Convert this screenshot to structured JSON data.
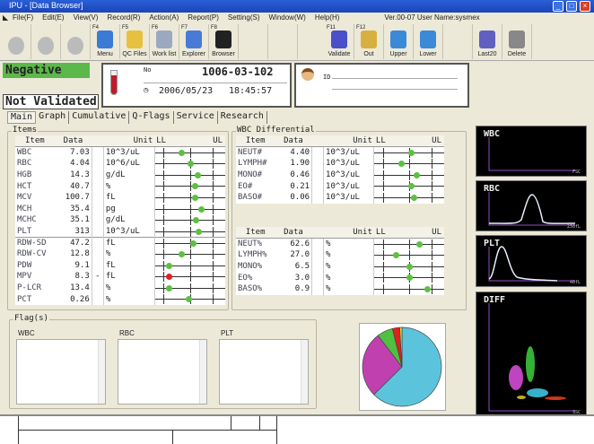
{
  "window": {
    "title": "IPU - [Data Browser]",
    "minimize": "_",
    "maximize": "□",
    "close": "×"
  },
  "menu": [
    "File(F)",
    "Edit(E)",
    "View(V)",
    "Record(R)",
    "Action(A)",
    "Report(P)",
    "Setting(S)",
    "Window(W)",
    "Help(H)"
  ],
  "version": "Ver.00-07 User Name:sysmex",
  "toolbar": [
    {
      "fk": "",
      "label": "",
      "disabled": true
    },
    {
      "fk": "",
      "label": "",
      "disabled": true
    },
    {
      "fk": "",
      "label": "",
      "disabled": true
    },
    {
      "fk": "F4",
      "label": "Menu",
      "color": "#3a7bd5"
    },
    {
      "fk": "F5",
      "label": "QC Files",
      "color": "#e8c040"
    },
    {
      "fk": "F6",
      "label": "Work list",
      "color": "#9aa8c0"
    },
    {
      "fk": "F7",
      "label": "Explorer",
      "color": "#4a7ad8"
    },
    {
      "fk": "F8",
      "label": "Browser",
      "color": "#222"
    },
    {
      "fk": "",
      "label": ""
    },
    {
      "fk": "",
      "label": ""
    },
    {
      "fk": "F11",
      "label": "Validate",
      "color": "#4a50c8"
    },
    {
      "fk": "F12",
      "label": "Out",
      "color": "#d8b040"
    },
    {
      "fk": "",
      "label": "Upper",
      "color": "#3a8ad8"
    },
    {
      "fk": "",
      "label": "Lower",
      "color": "#3a8ad8"
    },
    {
      "fk": "",
      "label": ""
    },
    {
      "fk": "",
      "label": "Last20",
      "color": "#6060c0"
    },
    {
      "fk": "",
      "label": "Delete",
      "color": "#888"
    }
  ],
  "status": {
    "result": "Negative",
    "validation": "Not Validated"
  },
  "sample": {
    "no_label": "No",
    "number": "1006-03-102",
    "date": "2006/05/23",
    "time": "18:45:57"
  },
  "patient": {
    "id_label": "ID"
  },
  "tabs": [
    "Main",
    "Graph",
    "Cumulative",
    "Q-Flags",
    "Service",
    "Research"
  ],
  "items": {
    "title": "Items",
    "headers": [
      "Item",
      "Data",
      "",
      "Unit",
      "LL",
      "UL"
    ],
    "rows": [
      {
        "item": "WBC",
        "data": "7.03",
        "flag": "",
        "unit": "10^3/uL",
        "pos": 0.37,
        "color": "#5cc040"
      },
      {
        "item": "RBC",
        "data": "4.04",
        "flag": "",
        "unit": "10^6/uL",
        "pos": 0.5,
        "color": "#5cc040"
      },
      {
        "item": "HGB",
        "data": "14.3",
        "flag": "",
        "unit": "g/dL",
        "pos": 0.6,
        "color": "#5cc040"
      },
      {
        "item": "HCT",
        "data": "40.7",
        "flag": "",
        "unit": "%",
        "pos": 0.57,
        "color": "#5cc040"
      },
      {
        "item": "MCV",
        "data": "100.7",
        "flag": "",
        "unit": "fL",
        "pos": 0.56,
        "color": "#5cc040"
      },
      {
        "item": "MCH",
        "data": "35.4",
        "flag": "",
        "unit": "pg",
        "pos": 0.66,
        "color": "#5cc040"
      },
      {
        "item": "MCHC",
        "data": "35.1",
        "flag": "",
        "unit": "g/dL",
        "pos": 0.58,
        "color": "#5cc040"
      },
      {
        "item": "PLT",
        "data": "313",
        "flag": "",
        "unit": "10^3/uL",
        "pos": 0.62,
        "color": "#5cc040"
      },
      {
        "item": "RDW-SD",
        "data": "47.2",
        "flag": "",
        "unit": "fL",
        "pos": 0.54,
        "color": "#5cc040"
      },
      {
        "item": "RDW-CV",
        "data": "12.8",
        "flag": "",
        "unit": "%",
        "pos": 0.38,
        "color": "#5cc040"
      },
      {
        "item": "PDW",
        "data": "9.1",
        "flag": "",
        "unit": "fL",
        "pos": 0.19,
        "color": "#5cc040"
      },
      {
        "item": "MPV",
        "data": "8.3",
        "flag": "-",
        "unit": "fL",
        "pos": 0.19,
        "color": "#e02020"
      },
      {
        "item": "P-LCR",
        "data": "13.4",
        "flag": "",
        "unit": "%",
        "pos": 0.19,
        "color": "#5cc040"
      },
      {
        "item": "PCT",
        "data": "0.26",
        "flag": "",
        "unit": "%",
        "pos": 0.48,
        "color": "#5cc040"
      }
    ]
  },
  "wbc_diff": {
    "title": "WBC Differential",
    "headers": [
      "Item",
      "Data",
      "",
      "Unit",
      "LL",
      "UL"
    ],
    "abs": [
      {
        "item": "NEUT#",
        "data": "4.40",
        "flag": "",
        "unit": "10^3/uL",
        "pos": 0.52,
        "color": "#5cc040"
      },
      {
        "item": "LYMPH#",
        "data": "1.90",
        "flag": "",
        "unit": "10^3/uL",
        "pos": 0.38,
        "color": "#5cc040"
      },
      {
        "item": "MONO#",
        "data": "0.46",
        "flag": "",
        "unit": "10^3/uL",
        "pos": 0.6,
        "color": "#5cc040"
      },
      {
        "item": "EO#",
        "data": "0.21",
        "flag": "",
        "unit": "10^3/uL",
        "pos": 0.52,
        "color": "#5cc040"
      },
      {
        "item": "BASO#",
        "data": "0.06",
        "flag": "",
        "unit": "10^3/uL",
        "pos": 0.56,
        "color": "#5cc040"
      }
    ],
    "pct": [
      {
        "item": "NEUT%",
        "data": "62.6",
        "flag": "",
        "unit": "%",
        "pos": 0.64,
        "color": "#5cc040"
      },
      {
        "item": "LYMPH%",
        "data": "27.0",
        "flag": "",
        "unit": "%",
        "pos": 0.3,
        "color": "#5cc040"
      },
      {
        "item": "MONO%",
        "data": "6.5",
        "flag": "",
        "unit": "%",
        "pos": 0.5,
        "color": "#5cc040"
      },
      {
        "item": "EO%",
        "data": "3.0",
        "flag": "",
        "unit": "%",
        "pos": 0.5,
        "color": "#5cc040"
      },
      {
        "item": "BASO%",
        "data": "0.9",
        "flag": "",
        "unit": "%",
        "pos": 0.76,
        "color": "#5cc040"
      }
    ]
  },
  "flags": {
    "title": "Flag(s)",
    "boxes": [
      "WBC",
      "RBC",
      "PLT"
    ]
  },
  "pie": [
    {
      "name": "NEUT",
      "value": 62.6,
      "color": "#5bc4dc"
    },
    {
      "name": "LYMPH",
      "value": 27.0,
      "color": "#c040b0"
    },
    {
      "name": "MONO",
      "value": 6.5,
      "color": "#50c040"
    },
    {
      "name": "EO",
      "value": 3.0,
      "color": "#e02020"
    },
    {
      "name": "BASO",
      "value": 0.9,
      "color": "#e8e020"
    }
  ],
  "scattergrams": [
    {
      "title": "WBC",
      "axis": "FSC"
    },
    {
      "title": "RBC",
      "axis": "250fL"
    },
    {
      "title": "PLT",
      "axis": "40fL"
    },
    {
      "title": "DIFF",
      "axis": "SSC"
    }
  ]
}
